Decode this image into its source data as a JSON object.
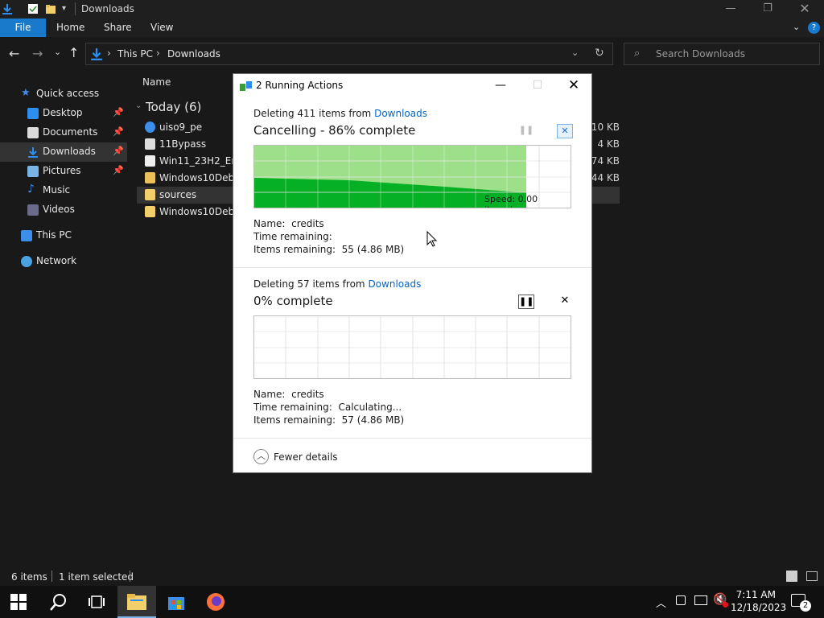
{
  "explorer": {
    "window_title": "Downloads",
    "ribbon_tabs": [
      "File",
      "Home",
      "Share",
      "View"
    ],
    "address": {
      "root": "This PC",
      "current": "Downloads"
    },
    "search_placeholder": "Search Downloads",
    "column_name": "Name",
    "group_header": "Today (6)",
    "nav": [
      {
        "label": "Quick access",
        "icon": "star-icon"
      },
      {
        "label": "Desktop",
        "icon": "desktop-icon",
        "pinned": true
      },
      {
        "label": "Documents",
        "icon": "documents-icon",
        "pinned": true
      },
      {
        "label": "Downloads",
        "icon": "download-icon",
        "pinned": true,
        "selected": true
      },
      {
        "label": "Pictures",
        "icon": "pictures-icon",
        "pinned": true
      },
      {
        "label": "Music",
        "icon": "music-icon"
      },
      {
        "label": "Videos",
        "icon": "videos-icon"
      },
      {
        "label": "This PC",
        "icon": "computer-icon"
      },
      {
        "label": "Network",
        "icon": "network-icon"
      }
    ],
    "files": [
      {
        "name": "uiso9_pe",
        "size": "010 KB",
        "icon": "app-icon"
      },
      {
        "name": "11Bypass",
        "size": "4 KB",
        "icon": "settings-file-icon"
      },
      {
        "name": "Win11_23H2_Eng",
        "size": "374 KB",
        "icon": "file-icon"
      },
      {
        "name": "Windows10Deblc",
        "size": "44 KB",
        "icon": "folder-zip-icon"
      },
      {
        "name": "sources",
        "size": "",
        "icon": "folder-icon",
        "selected": true
      },
      {
        "name": "Windows10Deblc",
        "size": "",
        "icon": "folder-icon"
      }
    ],
    "status": {
      "items": "6 items",
      "selected": "1 item selected"
    }
  },
  "dialog": {
    "title": "2 Running Actions",
    "op1": {
      "prefix": "Deleting 411 items from",
      "location": "Downloads",
      "status": "Cancelling - 86% complete",
      "progress": 0.86,
      "speed": "Speed: 0.00 items/s",
      "name_label": "Name:",
      "name": "credits",
      "time_label": "Time remaining:",
      "time": "",
      "items_label": "Items remaining:",
      "items": "55 (4.86 MB)"
    },
    "op2": {
      "prefix": "Deleting 57 items from",
      "location": "Downloads",
      "status": "0% complete",
      "progress": 0.0,
      "name_label": "Name:",
      "name": "credits",
      "time_label": "Time remaining:",
      "time": "Calculating...",
      "items_label": "Items remaining:",
      "items": "57 (4.86 MB)"
    },
    "fewer_details": "Fewer details"
  },
  "taskbar": {
    "time": "7:11 AM",
    "date": "12/18/2023",
    "notifications": "2"
  },
  "colors": {
    "accent": "#1979ca",
    "progress_light": "#9de089",
    "progress_dark": "#06b025",
    "link": "#0066cc"
  }
}
